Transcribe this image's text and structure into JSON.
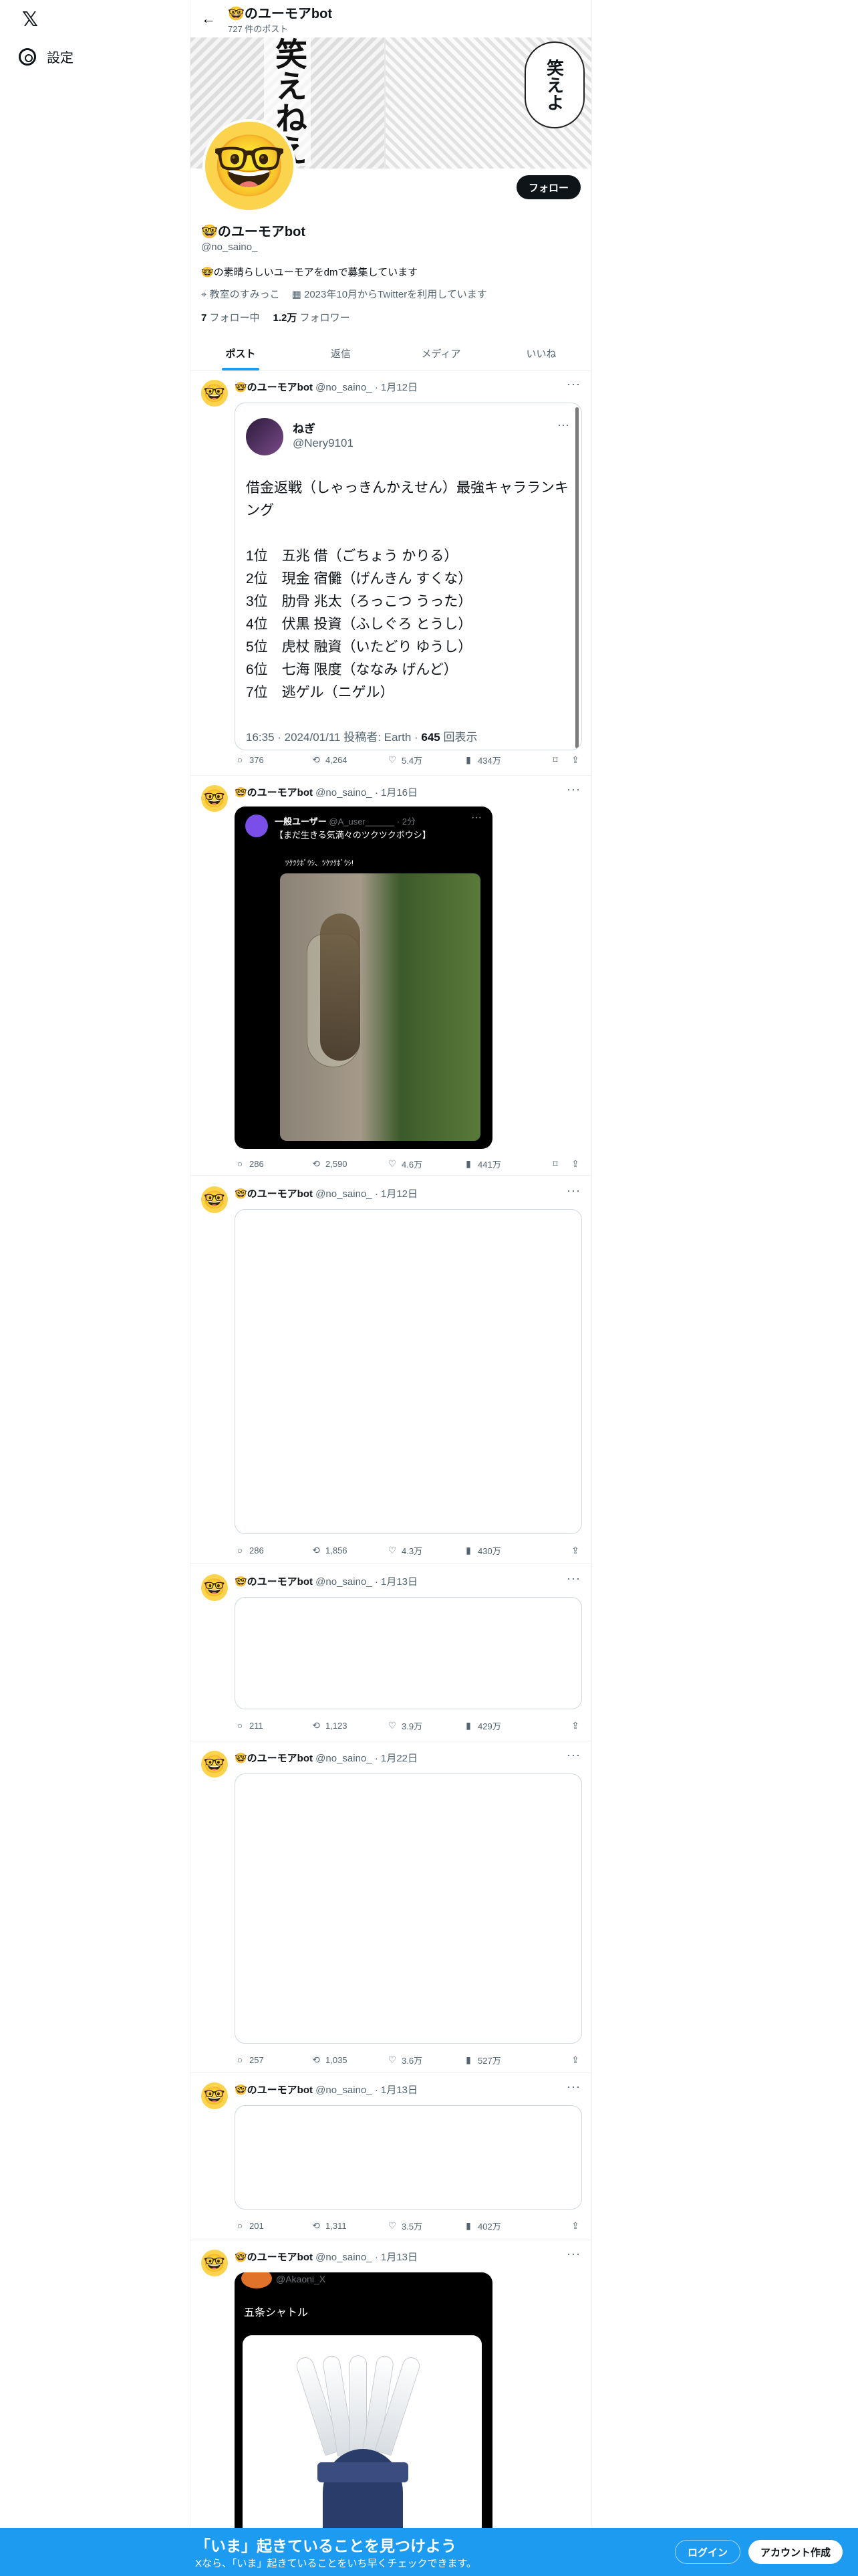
{
  "nav": {
    "settings_label": "設定",
    "logo": "𝕏"
  },
  "profile": {
    "display_name": "🤓のユーモアbot",
    "post_count": "727 件のポスト",
    "handle": "@no_saino_",
    "bio": "🤓の素晴らしいユーモアをdmで募集しています",
    "location": "教室のすみっこ",
    "joined": "2023年10月からTwitterを利用しています",
    "following_num": "7",
    "following_label": "フォロー中",
    "followers_num": "1.2万",
    "followers_label": "フォロワー",
    "follow_button": "フォロー",
    "banner_text_left": "笑えねえ",
    "banner_text_right": "笑えよ"
  },
  "tabs": [
    "ポスト",
    "返信",
    "メディア",
    "いいね"
  ],
  "tweets": [
    {
      "name": "🤓のユーモアbot",
      "handle": "@no_saino_",
      "date": "· 1月12日",
      "quote": {
        "name": "ねぎ",
        "handle": "@Nery9101",
        "text": "借金返戦（しゃっきんかえせん）最強キャラランキング\n\n1位　五兆 借（ごちょう かりる）\n2位　現金 宿儺（げんきん すくな）\n3位　肋骨 兆太（ろっこつ うった）\n4位　伏黒 投資（ふしぐろ とうし）\n5位　虎杖 融資（いたどり ゆうし）\n6位　七海 限度（ななみ げんど）\n7位　逃ゲル（ニゲル）",
        "footer": "16:35 · 2024/01/11 投稿者: Earth · ",
        "views": "645",
        "views_label": "回表示"
      },
      "replies": "376",
      "retweets": "4,264",
      "likes": "5.4万",
      "views": "434万"
    },
    {
      "name": "🤓のユーモアbot",
      "handle": "@no_saino_",
      "date": "· 1月16日",
      "dark": {
        "user": "一般ユーザー",
        "user_handle": "@A_user______ · 2分",
        "text": "【まだ生きる気満々のツクツクボウシ】",
        "sub": "ﾂｸﾂｸﾎﾞｳｼ、ﾂｸﾂｸﾎﾞｳｼ!"
      },
      "replies": "286",
      "retweets": "2,590",
      "likes": "4.6万",
      "views": "441万"
    },
    {
      "name": "🤓のユーモアbot",
      "handle": "@no_saino_",
      "date": "· 1月12日",
      "replies": "286",
      "retweets": "1,856",
      "likes": "4.3万",
      "views": "430万"
    },
    {
      "name": "🤓のユーモアbot",
      "handle": "@no_saino_",
      "date": "· 1月13日",
      "replies": "211",
      "retweets": "1,123",
      "likes": "3.9万",
      "views": "429万"
    },
    {
      "name": "🤓のユーモアbot",
      "handle": "@no_saino_",
      "date": "· 1月22日",
      "replies": "257",
      "retweets": "1,035",
      "likes": "3.6万",
      "views": "527万"
    },
    {
      "name": "🤓のユーモアbot",
      "handle": "@no_saino_",
      "date": "· 1月13日",
      "replies": "201",
      "retweets": "1,311",
      "likes": "3.5万",
      "views": "402万"
    },
    {
      "name": "🤓のユーモアbot",
      "handle": "@no_saino_",
      "date": "· 1月13日",
      "shuttle": {
        "handle": "@Akaoni_X",
        "text": "五条シャトル"
      }
    }
  ],
  "bottom": {
    "title": "「いま」起きていることを見つけよう",
    "subtitle": "Xなら、「いま」起きていることをいち早くチェックできます。",
    "login": "ログイン",
    "signup": "アカウント作成"
  },
  "icons": {
    "reply": "💬",
    "retweet": "⟲",
    "like": "♡",
    "views": "📊",
    "bookmark": "🔖",
    "share": "⇪"
  },
  "colors": {
    "accent": "#1d9bf0",
    "text": "#0f1419",
    "muted": "#536471"
  }
}
